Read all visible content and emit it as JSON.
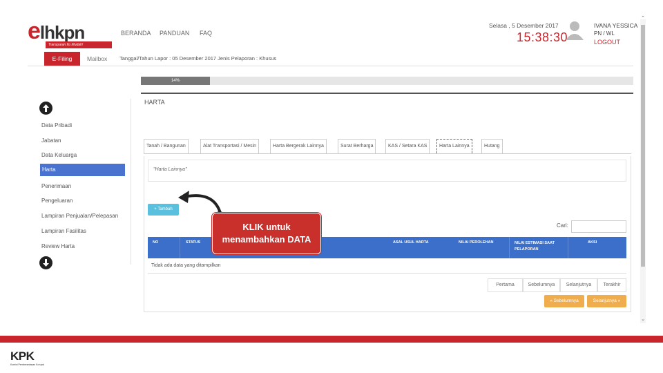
{
  "header": {
    "logo_text": "lhkpn",
    "logo_letter": "e",
    "logo_tagline": "Transparan Itu Mudah!",
    "nav": [
      "BERANDA",
      "PANDUAN",
      "FAQ"
    ],
    "date": "Selasa , 5 Desember 2017",
    "time": "15:38:30",
    "user_name": "IVANA YESSICA",
    "user_role": "PN / WL",
    "logout": "LOGOUT"
  },
  "subbar": {
    "efiling": "E-Filing",
    "mailbox": "Mailbox",
    "report_info": "Tanggal/Tahun Lapor : 05 Desember 2017   Jenis Pelaporan : Khusus"
  },
  "progress": {
    "label": "14%",
    "value": 0.14
  },
  "sidebar": {
    "items": [
      "Data Pribadi",
      "Jabatan",
      "Data Keluarga",
      "Harta",
      "Penerimaan",
      "Pengeluaran",
      "Lampiran Penjualan/Pelepasan",
      "Lampiran Fasilitas",
      "Review Harta"
    ],
    "active_index": 3
  },
  "main": {
    "title": "HARTA",
    "tabs": [
      "Tanah / Bangunan",
      "Alat Transportasi / Mesin",
      "Harta Bergerak Lainnya",
      "Surat Berharga",
      "KAS / Setara KAS",
      "Harta Lainnya",
      "Hutang"
    ],
    "active_tab": 5,
    "section_label": "\"Harta Lainnya\"",
    "add_button": "+ Tambah",
    "search_label": "Cari:",
    "search_value": "",
    "table_headers": [
      "NO",
      "STATUS",
      "ASAL USUL HARTA",
      "NILAI PEROLEHAN",
      "NILAI ESTIMASI SAAT PELAPORAN",
      "AKSI"
    ],
    "empty_text": "Tidak ada data yang ditampilkan",
    "pager": [
      "Pertama",
      "Sebelumnya",
      "Selanjutnya",
      "Terakhir"
    ],
    "prev_button": "« Sebelumnya",
    "next_button": "Selanjutnya »"
  },
  "callout": {
    "line1": "KLIK untuk",
    "line2": "menambahkan DATA"
  },
  "footer": {
    "logo": "KPK",
    "subtitle": "Komisi Pemberantasan Korupsi"
  },
  "colors": {
    "brand_red": "#c9252c",
    "accent_blue": "#3b6fc9",
    "orange": "#f0ad4e"
  }
}
